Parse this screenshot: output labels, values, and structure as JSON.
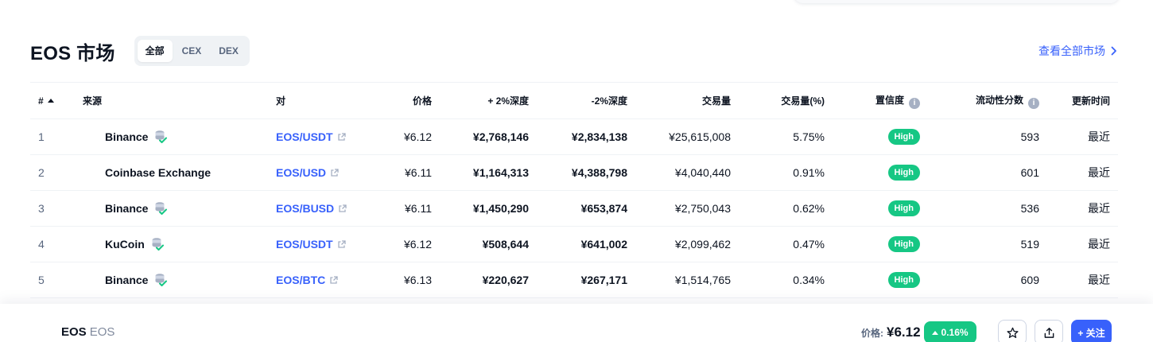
{
  "header": {
    "title": "EOS 市场",
    "filters": [
      "全部",
      "CEX",
      "DEX"
    ],
    "active_filter": 0,
    "view_all": "查看全部市场"
  },
  "table": {
    "columns": {
      "rank": "#",
      "source": "来源",
      "pair": "对",
      "price": "价格",
      "depth_plus": "+ 2%深度",
      "depth_minus": "-2%深度",
      "volume": "交易量",
      "volume_pct": "交易量(%)",
      "confidence": "置信度",
      "liquidity": "流动性分数",
      "updated": "更新时间"
    },
    "rows": [
      {
        "rank": "1",
        "source": "Binance",
        "verified": true,
        "pair": "EOS/USDT",
        "price": "¥6.12",
        "depth_plus": "¥2,768,146",
        "depth_minus": "¥2,834,138",
        "volume": "¥25,615,008",
        "volume_pct": "5.75%",
        "confidence": "High",
        "liquidity": "593",
        "updated": "最近"
      },
      {
        "rank": "2",
        "source": "Coinbase Exchange",
        "verified": false,
        "pair": "EOS/USD",
        "price": "¥6.11",
        "depth_plus": "¥1,164,313",
        "depth_minus": "¥4,388,798",
        "volume": "¥4,040,440",
        "volume_pct": "0.91%",
        "confidence": "High",
        "liquidity": "601",
        "updated": "最近"
      },
      {
        "rank": "3",
        "source": "Binance",
        "verified": true,
        "pair": "EOS/BUSD",
        "price": "¥6.11",
        "depth_plus": "¥1,450,290",
        "depth_minus": "¥653,874",
        "volume": "¥2,750,043",
        "volume_pct": "0.62%",
        "confidence": "High",
        "liquidity": "536",
        "updated": "最近"
      },
      {
        "rank": "4",
        "source": "KuCoin",
        "verified": true,
        "pair": "EOS/USDT",
        "price": "¥6.12",
        "depth_plus": "¥508,644",
        "depth_minus": "¥641,002",
        "volume": "¥2,099,462",
        "volume_pct": "0.47%",
        "confidence": "High",
        "liquidity": "519",
        "updated": "最近"
      },
      {
        "rank": "5",
        "source": "Binance",
        "verified": true,
        "pair": "EOS/BTC",
        "price": "¥6.13",
        "depth_plus": "¥220,627",
        "depth_minus": "¥267,171",
        "volume": "¥1,514,765",
        "volume_pct": "0.34%",
        "confidence": "High",
        "liquidity": "609",
        "updated": "最近"
      }
    ]
  },
  "sticky": {
    "coin_name": "EOS",
    "coin_symbol": "EOS",
    "price_label": "价格:",
    "price": "¥6.12",
    "change": "0.16%",
    "follow": "+ 关注"
  },
  "icons": {
    "verified": "database-check-icon",
    "external": "external-link-icon",
    "info": "info-icon",
    "star": "star-icon",
    "share": "share-icon",
    "chevron": "chevron-right-icon"
  },
  "colors": {
    "accent": "#3861fb",
    "positive": "#16c784",
    "muted": "#58667e"
  }
}
